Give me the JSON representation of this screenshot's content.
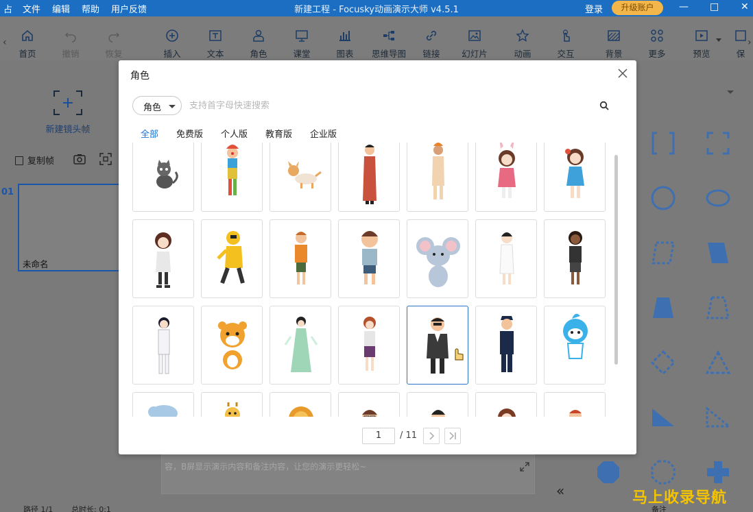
{
  "titlebar": {
    "app_icon": "app-pin-icon",
    "menus": [
      "文件",
      "编辑",
      "帮助",
      "用户反馈"
    ],
    "title": "新建工程 - Focusky动画演示大师  v4.5.1",
    "login": "登录",
    "upgrade": "升级账户"
  },
  "toolbar": {
    "items": [
      {
        "label": "首页"
      },
      {
        "label": "撤销"
      },
      {
        "label": "恢复"
      },
      {
        "label": "插入"
      },
      {
        "label": "文本"
      },
      {
        "label": "角色"
      },
      {
        "label": "课堂"
      },
      {
        "label": "图表"
      },
      {
        "label": "思维导图"
      },
      {
        "label": "链接"
      },
      {
        "label": "幻灯片"
      },
      {
        "label": "动画"
      },
      {
        "label": "交互"
      },
      {
        "label": "背景"
      },
      {
        "label": "更多"
      },
      {
        "label": "预览"
      },
      {
        "label": "保"
      }
    ]
  },
  "left": {
    "new_frame": "新建镜头帧",
    "copy_frame": "复制帧",
    "slide_number": "01",
    "slide_name": "未命名"
  },
  "dialog": {
    "title": "角色",
    "category": "角色",
    "search_placeholder": "支持首字母快速搜索",
    "tabs": [
      "全部",
      "免费版",
      "个人版",
      "教育版",
      "企业版"
    ],
    "active_tab": "全部",
    "page_current": "1",
    "page_total": "/ 11"
  },
  "notes": {
    "text": "容，B屏显示演示内容和备注内容，让您的演示更轻松~"
  },
  "status": {
    "path": "路径 1/1",
    "duration": "总时长: 0:1",
    "notes_label": "备注"
  },
  "watermark": "马上收录导航",
  "colors": {
    "titlebar": "#1b6ec2",
    "accent": "#1673d8",
    "upgrade": "#f2b64a",
    "shape_fill": "#3e6fb0"
  }
}
